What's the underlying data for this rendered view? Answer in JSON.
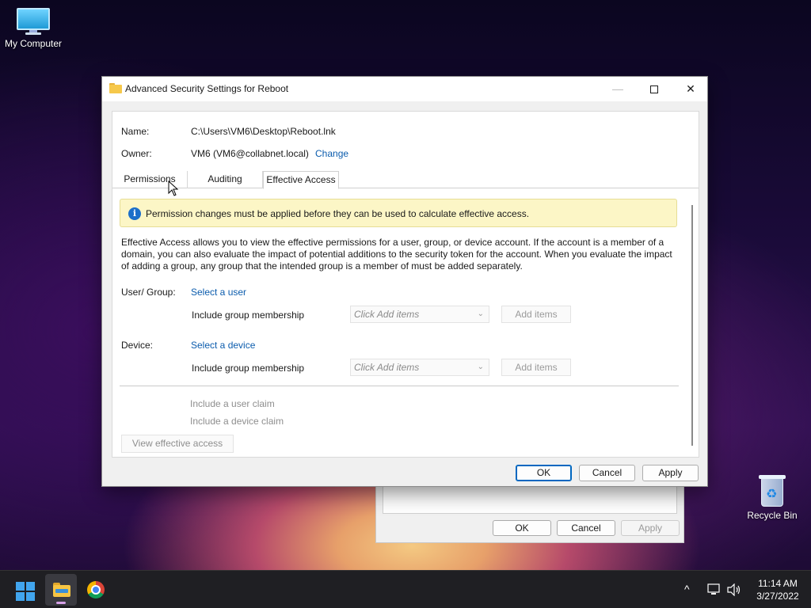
{
  "desktop": {
    "icons": [
      {
        "label": "My Computer",
        "icon": "monitor-icon"
      },
      {
        "label": "Recycle Bin",
        "icon": "recycle-bin-icon"
      }
    ]
  },
  "background_dialog": {
    "ok": "OK",
    "cancel": "Cancel",
    "apply": "Apply"
  },
  "window": {
    "title": "Advanced Security Settings for Reboot",
    "icon": "folder-icon",
    "controls": {
      "minimize": "—",
      "maximize": "maximize-icon",
      "close": "✕"
    },
    "name_label": "Name:",
    "name_value": "C:\\Users\\VM6\\Desktop\\Reboot.lnk",
    "owner_label": "Owner:",
    "owner_value": "VM6 (VM6@collabnet.local)",
    "owner_change": "Change",
    "tabs": [
      {
        "label": "Permissions",
        "active": false
      },
      {
        "label": "Auditing",
        "active": false
      },
      {
        "label": "Effective Access",
        "active": true
      }
    ],
    "info_bar": "Permission changes must be applied before they can be used to calculate effective access.",
    "description_lines": [
      "Effective Access allows you to view the effective permissions for a user, group, or device account. If the account is a member of a",
      "domain, you can also evaluate the impact of potential additions to the security token for the account. When you evaluate the impact",
      "of adding a group, any group that the intended group is a member of must be added separately."
    ],
    "user_group_label": "User/ Group:",
    "select_user": "Select a user",
    "include_group_label_1": "Include group membership",
    "combo_placeholder_1": "Click Add items",
    "add_items_1": "Add items",
    "device_label": "Device:",
    "select_device": "Select a device",
    "include_group_label_2": "Include group membership",
    "combo_placeholder_2": "Click Add items",
    "add_items_2": "Add items",
    "include_user_claim": "Include a user claim",
    "include_device_claim": "Include a device claim",
    "view_effective_access": "View effective access",
    "ok": "OK",
    "cancel": "Cancel",
    "apply": "Apply"
  },
  "taskbar": {
    "items": [
      "windows-start-icon",
      "file-explorer-icon",
      "chrome-icon"
    ],
    "tray": {
      "chevron": "^",
      "time": "11:14 AM",
      "date": "3/27/2022"
    }
  },
  "colors": {
    "link": "#0b5cad",
    "info_bar_bg": "#fcf6c6",
    "primary_button_border": "#0067c0",
    "taskbar_bg": "#1f1f23"
  }
}
